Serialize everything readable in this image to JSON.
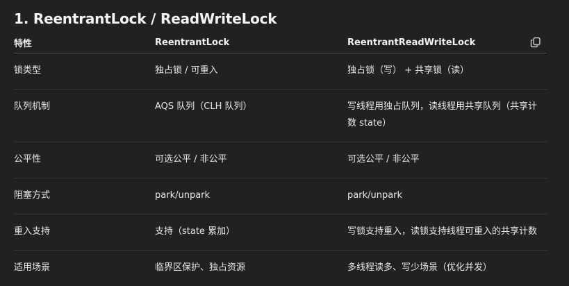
{
  "heading": "1. ReentrantLock / ReadWriteLock",
  "table": {
    "headers": [
      "特性",
      "ReentrantLock",
      "ReentrantReadWriteLock"
    ],
    "rows": [
      [
        "锁类型",
        "独占锁 / 可重入",
        "独占锁（写） + 共享锁（读）"
      ],
      [
        "队列机制",
        "AQS 队列（CLH 队列）",
        "写线程用独占队列，读线程用共享队列（共享计数 state）"
      ],
      [
        "公平性",
        "可选公平 / 非公平",
        "可选公平 / 非公平"
      ],
      [
        "阻塞方式",
        "park/unpark",
        "park/unpark"
      ],
      [
        "重入支持",
        "支持（state 累加）",
        "写锁支持重入，读锁支持线程可重入的共享计数"
      ],
      [
        "适用场景",
        "临界区保护、独占资源",
        "多线程读多、写少场景（优化并发）"
      ]
    ]
  },
  "icons": {
    "copy": "copy-icon"
  }
}
